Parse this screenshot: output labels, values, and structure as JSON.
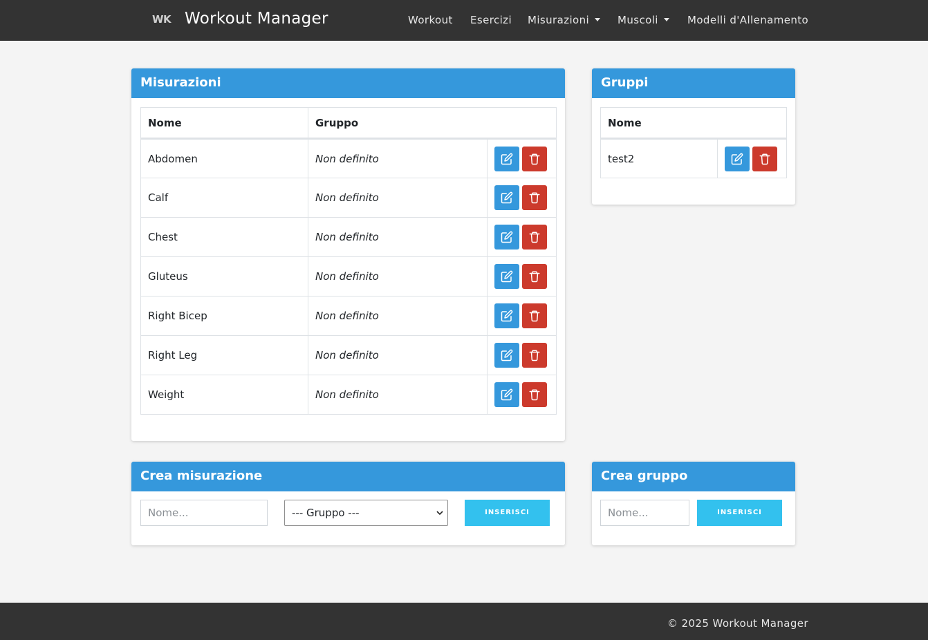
{
  "navbar": {
    "logo": "WK",
    "brand": "Workout Manager",
    "links": {
      "workout": "Workout",
      "esercizi": "Esercizi",
      "misurazioni": "Misurazioni",
      "muscoli": "Muscoli",
      "modelli": "Modelli d'Allenamento"
    }
  },
  "misurazioni": {
    "title": "Misurazioni",
    "headers": {
      "nome": "Nome",
      "gruppo": "Gruppo"
    },
    "rows": [
      {
        "nome": "Abdomen",
        "gruppo": "Non definito"
      },
      {
        "nome": "Calf",
        "gruppo": "Non definito"
      },
      {
        "nome": "Chest",
        "gruppo": "Non definito"
      },
      {
        "nome": "Gluteus",
        "gruppo": "Non definito"
      },
      {
        "nome": "Right Bicep",
        "gruppo": "Non definito"
      },
      {
        "nome": "Right Leg",
        "gruppo": "Non definito"
      },
      {
        "nome": "Weight",
        "gruppo": "Non definito"
      }
    ]
  },
  "gruppi": {
    "title": "Gruppi",
    "headers": {
      "nome": "Nome"
    },
    "rows": [
      {
        "nome": "test2"
      }
    ]
  },
  "crea_misurazione": {
    "title": "Crea misurazione",
    "nome_placeholder": "Nome...",
    "gruppo_selected": "--- Gruppo ---",
    "button": "INSERISCI"
  },
  "crea_gruppo": {
    "title": "Crea gruppo",
    "nome_placeholder": "Nome...",
    "button": "INSERISCI"
  },
  "footer": {
    "text": "© 2025 Workout Manager"
  },
  "colors": {
    "navbar": "#333333",
    "card_header": "#3598dc",
    "edit_button": "#3598dc",
    "delete_button": "#cc3a2c",
    "insert_button": "#33c1ee"
  },
  "icons": {
    "edit": "edit-icon",
    "delete": "trash-icon",
    "dropdown": "chevron-down-icon"
  }
}
